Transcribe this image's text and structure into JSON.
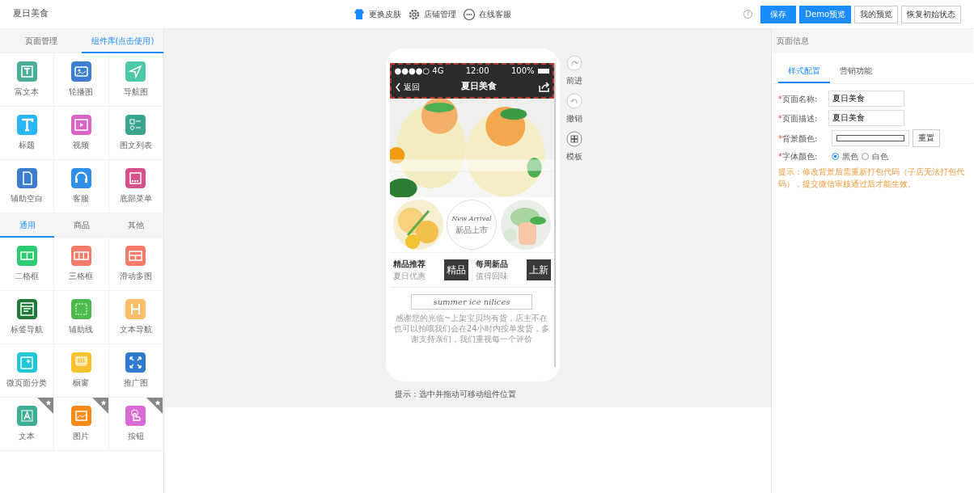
{
  "header": {
    "title": "夏日美食",
    "tools": [
      {
        "label": "更换皮肤"
      },
      {
        "label": "店铺管理"
      },
      {
        "label": "在线客服"
      }
    ],
    "help": "?",
    "buttons": [
      {
        "label": "保存",
        "primary": true
      },
      {
        "label": "Demo预览",
        "primary": true
      },
      {
        "label": "我的预览",
        "primary": false
      },
      {
        "label": "恢复初始状态",
        "primary": false
      }
    ]
  },
  "left_panel": {
    "tabs": [
      {
        "label": "页面管理",
        "selected": false
      },
      {
        "label": "组件库(点击使用)",
        "selected": true
      }
    ],
    "components": [
      {
        "label": "富文本",
        "color": "#4aae9b"
      },
      {
        "label": "轮播图",
        "color": "#3d7fcf"
      },
      {
        "label": "导航图",
        "color": "#4dc7a5"
      },
      {
        "label": "标题",
        "color": "#29b6f6"
      },
      {
        "label": "视频",
        "color": "#d966c6"
      },
      {
        "label": "图文列表",
        "color": "#3aa68f"
      },
      {
        "label": "辅助空白",
        "color": "#3b7ccc"
      },
      {
        "label": "客服",
        "color": "#2f90e8"
      },
      {
        "label": "底部菜单",
        "color": "#d6508a"
      }
    ],
    "sub_tabs": [
      {
        "label": "通用",
        "selected": true
      },
      {
        "label": "商品",
        "selected": false
      },
      {
        "label": "其他",
        "selected": false
      }
    ],
    "general_components": [
      {
        "label": "二格框",
        "color": "#2ecc71",
        "starred": false
      },
      {
        "label": "三格框",
        "color": "#f47b6c",
        "starred": false
      },
      {
        "label": "滑动多图",
        "color": "#f47b6c",
        "starred": false
      },
      {
        "label": "标签导航",
        "color": "#1f7a3a",
        "starred": false
      },
      {
        "label": "辅助线",
        "color": "#4cba4c",
        "starred": false
      },
      {
        "label": "文本导航",
        "color": "#fbbf6a",
        "starred": false
      },
      {
        "label": "微页面分类",
        "color": "#1ec8d8",
        "starred": false
      },
      {
        "label": "橱窗",
        "color": "#f9c12e",
        "starred": false
      },
      {
        "label": "推广图",
        "color": "#2f7ccc",
        "starred": false
      },
      {
        "label": "文本",
        "color": "#3fae96",
        "starred": true
      },
      {
        "label": "图片",
        "color": "#f98a15",
        "starred": true
      },
      {
        "label": "按钮",
        "color": "#d96cd4",
        "starred": true
      }
    ]
  },
  "phone": {
    "status_bar": {
      "signal": "●●●●○ 4G",
      "time": "12:00",
      "battery": "100%"
    },
    "nav": {
      "back": "返回",
      "title": "夏日美食"
    },
    "badge_circle": {
      "script": "New Arrival",
      "label": "新品上市"
    },
    "promos": [
      {
        "title": "精品推荐",
        "subtitle": "夏日优惠",
        "tag": "精品"
      },
      {
        "title": "每周新品",
        "subtitle": "值得回味",
        "tag": "上新"
      }
    ],
    "banner": "summer ice nilices",
    "paragraph": "感谢您的光临~上架宝贝均有货，店主不在也可以拍哦我们会在24小时内按单发货，多谢支持亲们，我们重视每一个评价"
  },
  "side_actions": [
    {
      "label": "前进"
    },
    {
      "label": "撤销"
    },
    {
      "label": "模板"
    }
  ],
  "canvas_hint": "提示：选中并拖动可移动组件位置",
  "right_panel": {
    "title": "页面信息",
    "tabs": [
      {
        "label": "样式配置",
        "selected": true
      },
      {
        "label": "营销功能",
        "selected": false
      }
    ],
    "fields": [
      {
        "mark": "*",
        "label": "页面名称:",
        "value": "夏日美食"
      },
      {
        "mark": "*",
        "label": "页面描述:",
        "value": "夏日美食"
      }
    ],
    "bg_color": {
      "mark": "*",
      "label": "背景颜色:",
      "reset": "重置"
    },
    "font_color": {
      "mark": "*",
      "label": "字体颜色:",
      "options": [
        {
          "label": "黑色",
          "selected": true
        },
        {
          "label": "白色",
          "selected": false
        }
      ]
    },
    "tip": "提示：修改背景后需重新打包代码（子店无法打包代码），提交微信审核通过后才能生效。"
  }
}
